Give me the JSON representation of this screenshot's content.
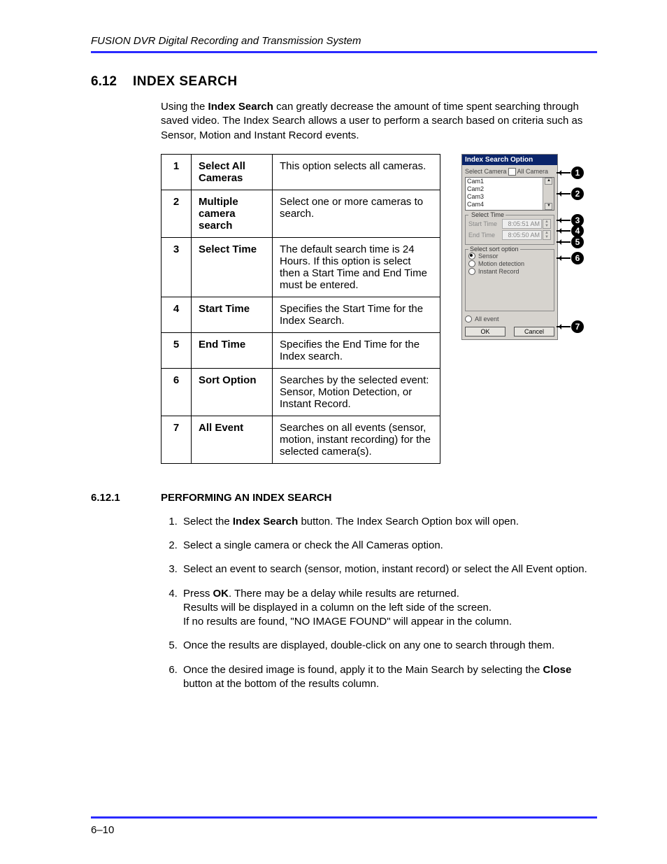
{
  "header": "FUSION DVR Digital Recording and Transmission System",
  "section": {
    "number": "6.12",
    "title": "INDEX SEARCH"
  },
  "intro": {
    "t1": "Using the ",
    "b1": "Index Search",
    "t2": " can greatly decrease the amount of time spent searching through saved video. The Index Search allows a user to perform a search based on criteria such as Sensor, Motion and Instant Record events."
  },
  "table": [
    {
      "n": "1",
      "label": "Select All Cameras",
      "desc": "This option selects all cameras."
    },
    {
      "n": "2",
      "label": "Multiple camera search",
      "desc": "Select one or more cameras to search."
    },
    {
      "n": "3",
      "label": "Select Time",
      "desc": "The default search time is 24 Hours. If this option is select then a Start Time and End Time must be entered."
    },
    {
      "n": "4",
      "label": "Start Time",
      "desc": "Specifies the Start Time for the Index Search."
    },
    {
      "n": "5",
      "label": "End Time",
      "desc": "Specifies the End Time for the Index search."
    },
    {
      "n": "6",
      "label": "Sort Option",
      "desc": "Searches by the selected event: Sensor, Motion Detection, or Instant Record."
    },
    {
      "n": "7",
      "label": "All Event",
      "desc": "Searches on all events (sensor, motion, instant recording) for the selected camera(s)."
    }
  ],
  "dialog": {
    "title": "Index Search Option",
    "sel_camera": "Select Camera",
    "all_camera": "All Camera",
    "cams": [
      "Cam1",
      "Cam2",
      "Cam3",
      "Cam4"
    ],
    "select_time": "Select Time",
    "start_time_label": "Start Time",
    "start_time_value": "8:05:51 AM",
    "end_time_label": "End Time",
    "end_time_value": "8:05:50 AM",
    "sort_legend": "Select sort option",
    "r_sensor": "Sensor",
    "r_motion": "Motion detection",
    "r_instant": "Instant Record",
    "r_all": "All event",
    "btn_ok": "OK",
    "btn_cancel": "Cancel"
  },
  "callouts": [
    "1",
    "2",
    "3",
    "4",
    "5",
    "6",
    "7"
  ],
  "subsection": {
    "number": "6.12.1",
    "title": "PERFORMING AN INDEX SEARCH"
  },
  "steps": {
    "s1a": "Select the ",
    "s1b": "Index Search",
    "s1c": " button. The Index Search Option box will open.",
    "s2": "Select a single camera or check the All Cameras option.",
    "s3": "Select an event to search (sensor, motion, instant record) or select the All Event option.",
    "s4a": "Press ",
    "s4b": "OK",
    "s4c": ". There may be a delay while results are returned.",
    "s4d": "Results will be displayed in a column on the left side of the screen.",
    "s4e": "If no results are found, \"NO IMAGE FOUND\" will appear in the column.",
    "s5": "Once the results are displayed, double-click on any one to search through them.",
    "s6a": "Once the desired image is found, apply it to the Main Search by selecting the ",
    "s6b": "Close",
    "s6c": " button at the bottom of the results column."
  },
  "footer": "6–10"
}
